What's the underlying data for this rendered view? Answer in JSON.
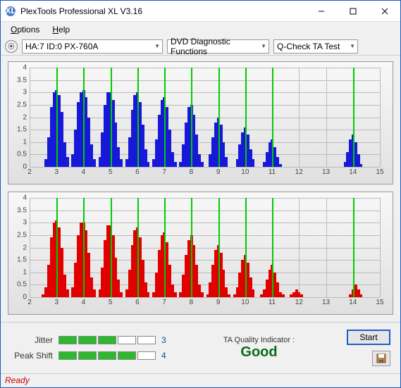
{
  "window": {
    "title": "PlexTools Professional XL V3.16"
  },
  "menu": {
    "options": "Options",
    "help": "Help"
  },
  "toolbar": {
    "drive": "HA:7 ID:0  PX-760A",
    "func": "DVD Diagnostic Functions",
    "test": "Q-Check TA Test"
  },
  "chart_data": [
    {
      "type": "bar",
      "xlabel": "",
      "ylabel": "",
      "ylim": [
        0,
        4
      ],
      "xlim": [
        2,
        15
      ],
      "yticks": [
        0,
        0.5,
        1,
        1.5,
        2,
        2.5,
        3,
        3.5,
        4
      ],
      "xticks": [
        2,
        3,
        4,
        5,
        6,
        7,
        8,
        9,
        10,
        11,
        12,
        13,
        14,
        15
      ],
      "greenlines": [
        3,
        4,
        5,
        6,
        7,
        8,
        9,
        10,
        11,
        14
      ],
      "color": "#1818d8",
      "series": [
        {
          "x": 2.6,
          "v": 0.3
        },
        {
          "x": 2.7,
          "v": 1.2
        },
        {
          "x": 2.8,
          "v": 2.4
        },
        {
          "x": 2.9,
          "v": 3.0
        },
        {
          "x": 3.0,
          "v": 3.1
        },
        {
          "x": 3.1,
          "v": 2.9
        },
        {
          "x": 3.2,
          "v": 2.2
        },
        {
          "x": 3.3,
          "v": 1.0
        },
        {
          "x": 3.4,
          "v": 0.4
        },
        {
          "x": 3.6,
          "v": 0.5
        },
        {
          "x": 3.7,
          "v": 1.5
        },
        {
          "x": 3.8,
          "v": 2.6
        },
        {
          "x": 3.9,
          "v": 3.0
        },
        {
          "x": 4.0,
          "v": 3.1
        },
        {
          "x": 4.1,
          "v": 2.8
        },
        {
          "x": 4.2,
          "v": 2.0
        },
        {
          "x": 4.3,
          "v": 0.9
        },
        {
          "x": 4.4,
          "v": 0.3
        },
        {
          "x": 4.6,
          "v": 0.4
        },
        {
          "x": 4.7,
          "v": 1.4
        },
        {
          "x": 4.8,
          "v": 2.5
        },
        {
          "x": 4.9,
          "v": 3.0
        },
        {
          "x": 5.0,
          "v": 3.0
        },
        {
          "x": 5.1,
          "v": 2.7
        },
        {
          "x": 5.2,
          "v": 1.8
        },
        {
          "x": 5.3,
          "v": 0.8
        },
        {
          "x": 5.4,
          "v": 0.3
        },
        {
          "x": 5.6,
          "v": 0.3
        },
        {
          "x": 5.7,
          "v": 1.2
        },
        {
          "x": 5.8,
          "v": 2.3
        },
        {
          "x": 5.9,
          "v": 2.9
        },
        {
          "x": 6.0,
          "v": 3.0
        },
        {
          "x": 6.1,
          "v": 2.6
        },
        {
          "x": 6.2,
          "v": 1.7
        },
        {
          "x": 6.3,
          "v": 0.7
        },
        {
          "x": 6.4,
          "v": 0.2
        },
        {
          "x": 6.6,
          "v": 0.3
        },
        {
          "x": 6.7,
          "v": 1.1
        },
        {
          "x": 6.8,
          "v": 2.1
        },
        {
          "x": 6.9,
          "v": 2.7
        },
        {
          "x": 7.0,
          "v": 2.8
        },
        {
          "x": 7.1,
          "v": 2.4
        },
        {
          "x": 7.2,
          "v": 1.5
        },
        {
          "x": 7.3,
          "v": 0.6
        },
        {
          "x": 7.4,
          "v": 0.2
        },
        {
          "x": 7.6,
          "v": 0.2
        },
        {
          "x": 7.7,
          "v": 0.9
        },
        {
          "x": 7.8,
          "v": 1.8
        },
        {
          "x": 7.9,
          "v": 2.4
        },
        {
          "x": 8.0,
          "v": 2.5
        },
        {
          "x": 8.1,
          "v": 2.1
        },
        {
          "x": 8.2,
          "v": 1.3
        },
        {
          "x": 8.3,
          "v": 0.5
        },
        {
          "x": 8.4,
          "v": 0.2
        },
        {
          "x": 8.7,
          "v": 0.5
        },
        {
          "x": 8.8,
          "v": 1.2
        },
        {
          "x": 8.9,
          "v": 1.8
        },
        {
          "x": 9.0,
          "v": 2.0
        },
        {
          "x": 9.1,
          "v": 1.7
        },
        {
          "x": 9.2,
          "v": 1.0
        },
        {
          "x": 9.3,
          "v": 0.4
        },
        {
          "x": 9.7,
          "v": 0.3
        },
        {
          "x": 9.8,
          "v": 0.9
        },
        {
          "x": 9.9,
          "v": 1.4
        },
        {
          "x": 10.0,
          "v": 1.6
        },
        {
          "x": 10.1,
          "v": 1.3
        },
        {
          "x": 10.2,
          "v": 0.7
        },
        {
          "x": 10.3,
          "v": 0.3
        },
        {
          "x": 10.7,
          "v": 0.2
        },
        {
          "x": 10.8,
          "v": 0.6
        },
        {
          "x": 10.9,
          "v": 1.0
        },
        {
          "x": 11.0,
          "v": 1.1
        },
        {
          "x": 11.1,
          "v": 0.8
        },
        {
          "x": 11.2,
          "v": 0.4
        },
        {
          "x": 11.3,
          "v": 0.1
        },
        {
          "x": 13.7,
          "v": 0.2
        },
        {
          "x": 13.8,
          "v": 0.6
        },
        {
          "x": 13.9,
          "v": 1.1
        },
        {
          "x": 14.0,
          "v": 1.3
        },
        {
          "x": 14.1,
          "v": 1.0
        },
        {
          "x": 14.2,
          "v": 0.5
        },
        {
          "x": 14.3,
          "v": 0.1
        }
      ]
    },
    {
      "type": "bar",
      "xlabel": "",
      "ylabel": "",
      "ylim": [
        0,
        4
      ],
      "xlim": [
        2,
        15
      ],
      "yticks": [
        0,
        0.5,
        1,
        1.5,
        2,
        2.5,
        3,
        3.5,
        4
      ],
      "xticks": [
        2,
        3,
        4,
        5,
        6,
        7,
        8,
        9,
        10,
        11,
        12,
        13,
        14,
        15
      ],
      "greenlines": [
        3,
        4,
        5,
        6,
        7,
        8,
        9,
        10,
        11,
        14
      ],
      "color": "#e00000",
      "series": [
        {
          "x": 2.5,
          "v": 0.1
        },
        {
          "x": 2.6,
          "v": 0.4
        },
        {
          "x": 2.7,
          "v": 1.3
        },
        {
          "x": 2.8,
          "v": 2.4
        },
        {
          "x": 2.9,
          "v": 3.0
        },
        {
          "x": 3.0,
          "v": 3.1
        },
        {
          "x": 3.1,
          "v": 2.8
        },
        {
          "x": 3.2,
          "v": 2.0
        },
        {
          "x": 3.3,
          "v": 0.9
        },
        {
          "x": 3.4,
          "v": 0.3
        },
        {
          "x": 3.6,
          "v": 0.4
        },
        {
          "x": 3.7,
          "v": 1.4
        },
        {
          "x": 3.8,
          "v": 2.5
        },
        {
          "x": 3.9,
          "v": 3.0
        },
        {
          "x": 4.0,
          "v": 3.0
        },
        {
          "x": 4.1,
          "v": 2.7
        },
        {
          "x": 4.2,
          "v": 1.8
        },
        {
          "x": 4.3,
          "v": 0.8
        },
        {
          "x": 4.4,
          "v": 0.3
        },
        {
          "x": 4.6,
          "v": 0.3
        },
        {
          "x": 4.7,
          "v": 1.2
        },
        {
          "x": 4.8,
          "v": 2.3
        },
        {
          "x": 4.9,
          "v": 2.9
        },
        {
          "x": 5.0,
          "v": 2.9
        },
        {
          "x": 5.1,
          "v": 2.5
        },
        {
          "x": 5.2,
          "v": 1.6
        },
        {
          "x": 5.3,
          "v": 0.7
        },
        {
          "x": 5.4,
          "v": 0.2
        },
        {
          "x": 5.6,
          "v": 0.3
        },
        {
          "x": 5.7,
          "v": 1.1
        },
        {
          "x": 5.8,
          "v": 2.1
        },
        {
          "x": 5.9,
          "v": 2.7
        },
        {
          "x": 6.0,
          "v": 2.8
        },
        {
          "x": 6.1,
          "v": 2.4
        },
        {
          "x": 6.2,
          "v": 1.5
        },
        {
          "x": 6.3,
          "v": 0.6
        },
        {
          "x": 6.4,
          "v": 0.2
        },
        {
          "x": 6.6,
          "v": 0.2
        },
        {
          "x": 6.7,
          "v": 1.0
        },
        {
          "x": 6.8,
          "v": 1.9
        },
        {
          "x": 6.9,
          "v": 2.5
        },
        {
          "x": 7.0,
          "v": 2.6
        },
        {
          "x": 7.1,
          "v": 2.2
        },
        {
          "x": 7.2,
          "v": 1.3
        },
        {
          "x": 7.3,
          "v": 0.5
        },
        {
          "x": 7.4,
          "v": 0.2
        },
        {
          "x": 7.6,
          "v": 0.2
        },
        {
          "x": 7.7,
          "v": 0.9
        },
        {
          "x": 7.8,
          "v": 1.7
        },
        {
          "x": 7.9,
          "v": 2.3
        },
        {
          "x": 8.0,
          "v": 2.5
        },
        {
          "x": 8.1,
          "v": 2.1
        },
        {
          "x": 8.2,
          "v": 1.3
        },
        {
          "x": 8.3,
          "v": 0.5
        },
        {
          "x": 8.4,
          "v": 0.2
        },
        {
          "x": 8.6,
          "v": 0.1
        },
        {
          "x": 8.7,
          "v": 0.6
        },
        {
          "x": 8.8,
          "v": 1.3
        },
        {
          "x": 8.9,
          "v": 1.9
        },
        {
          "x": 9.0,
          "v": 2.1
        },
        {
          "x": 9.1,
          "v": 1.8
        },
        {
          "x": 9.2,
          "v": 1.1
        },
        {
          "x": 9.3,
          "v": 0.4
        },
        {
          "x": 9.4,
          "v": 0.1
        },
        {
          "x": 9.6,
          "v": 0.1
        },
        {
          "x": 9.7,
          "v": 0.4
        },
        {
          "x": 9.8,
          "v": 1.0
        },
        {
          "x": 9.9,
          "v": 1.5
        },
        {
          "x": 10.0,
          "v": 1.7
        },
        {
          "x": 10.1,
          "v": 1.4
        },
        {
          "x": 10.2,
          "v": 0.8
        },
        {
          "x": 10.3,
          "v": 0.3
        },
        {
          "x": 10.6,
          "v": 0.1
        },
        {
          "x": 10.7,
          "v": 0.3
        },
        {
          "x": 10.8,
          "v": 0.7
        },
        {
          "x": 10.9,
          "v": 1.1
        },
        {
          "x": 11.0,
          "v": 1.3
        },
        {
          "x": 11.1,
          "v": 1.0
        },
        {
          "x": 11.2,
          "v": 0.6
        },
        {
          "x": 11.3,
          "v": 0.2
        },
        {
          "x": 11.4,
          "v": 0.1
        },
        {
          "x": 11.7,
          "v": 0.1
        },
        {
          "x": 11.8,
          "v": 0.2
        },
        {
          "x": 11.9,
          "v": 0.3
        },
        {
          "x": 12.0,
          "v": 0.2
        },
        {
          "x": 12.1,
          "v": 0.1
        },
        {
          "x": 13.9,
          "v": 0.1
        },
        {
          "x": 14.0,
          "v": 0.3
        },
        {
          "x": 14.1,
          "v": 0.5
        },
        {
          "x": 14.2,
          "v": 0.3
        },
        {
          "x": 14.3,
          "v": 0.1
        }
      ]
    }
  ],
  "meters": {
    "jitter": {
      "label": "Jitter",
      "value": 3,
      "segments": 5
    },
    "peak": {
      "label": "Peak Shift",
      "value": 4,
      "segments": 5
    }
  },
  "ta": {
    "label": "TA Quality Indicator :",
    "value": "Good"
  },
  "buttons": {
    "start": "Start"
  },
  "status": {
    "text": "Ready"
  }
}
